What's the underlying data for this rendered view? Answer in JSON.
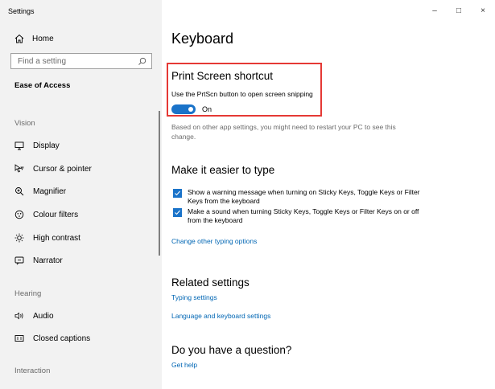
{
  "window": {
    "title": "Settings",
    "controls": [
      "–",
      "□",
      "×"
    ]
  },
  "sidebar": {
    "home_label": "Home",
    "search_placeholder": "Find a setting",
    "current_section": "Ease of Access",
    "groups": {
      "vision": "Vision",
      "hearing": "Hearing",
      "interaction": "Interaction"
    },
    "items": {
      "display": "Display",
      "cursor": "Cursor & pointer",
      "magnifier": "Magnifier",
      "colour_filters": "Colour filters",
      "high_contrast": "High contrast",
      "narrator": "Narrator",
      "audio": "Audio",
      "closed_captions": "Closed captions"
    }
  },
  "main": {
    "title": "Keyboard",
    "print_screen": {
      "heading": "Print Screen shortcut",
      "description": "Use the PrtScn button to open screen snipping",
      "toggle_state": "On",
      "note": "Based on other app settings, you might need to restart your PC to see this change."
    },
    "typing": {
      "heading": "Make it easier to type",
      "checkbox1": "Show a warning message when turning on Sticky Keys, Toggle Keys or Filter Keys from the keyboard",
      "checkbox2": "Make a sound when turning Sticky Keys, Toggle Keys or Filter Keys on or off from the keyboard",
      "link": "Change other typing options"
    },
    "related": {
      "heading": "Related settings",
      "link1": "Typing settings",
      "link2": "Language and keyboard settings"
    },
    "question": {
      "heading": "Do you have a question?",
      "link": "Get help"
    }
  },
  "colors": {
    "accent": "#1a73c9",
    "highlight": "#e53935",
    "link": "#0066b4"
  }
}
